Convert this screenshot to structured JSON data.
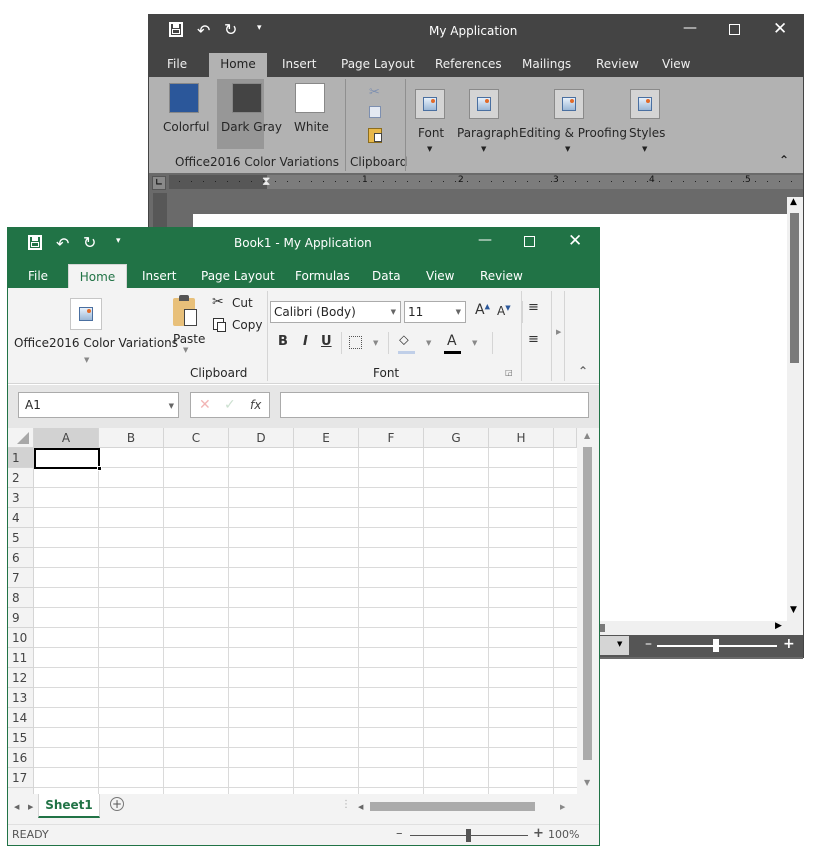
{
  "word_window": {
    "title": "My Application",
    "qat": [
      "save-icon",
      "undo-icon",
      "redo-icon",
      "customize-icon"
    ],
    "tabs": [
      {
        "label": "File",
        "active": false
      },
      {
        "label": "Home",
        "active": true
      },
      {
        "label": "Insert",
        "active": false
      },
      {
        "label": "Page Layout",
        "active": false
      },
      {
        "label": "References",
        "active": false
      },
      {
        "label": "Mailings",
        "active": false
      },
      {
        "label": "Review",
        "active": false
      },
      {
        "label": "View",
        "active": false
      }
    ],
    "ribbon": {
      "color_variations": {
        "group_label": "Office2016 Color Variations",
        "items": [
          {
            "label": "Colorful",
            "color": "#2b579a",
            "selected": false
          },
          {
            "label": "Dark Gray",
            "color": "#444444",
            "selected": true
          },
          {
            "label": "White",
            "color": "#ffffff",
            "selected": false
          }
        ]
      },
      "clipboard": {
        "group_label": "Clipboard",
        "icons": [
          "cut-icon",
          "copy-icon",
          "paste-icon"
        ]
      },
      "collapsed_groups": [
        {
          "label": "Font"
        },
        {
          "label": "Paragraph"
        },
        {
          "label": "Editing & Proofing"
        },
        {
          "label": "Styles"
        }
      ]
    },
    "ruler": {
      "numbers": [
        "1",
        "2",
        "3",
        "4",
        "5"
      ]
    },
    "zoom_slider": {
      "value_fraction": 0.5
    }
  },
  "excel_window": {
    "title": "Book1 - My Application",
    "tabs": [
      {
        "label": "File",
        "active": false
      },
      {
        "label": "Home",
        "active": true
      },
      {
        "label": "Insert",
        "active": false
      },
      {
        "label": "Page Layout",
        "active": false
      },
      {
        "label": "Formulas",
        "active": false
      },
      {
        "label": "Data",
        "active": false
      },
      {
        "label": "View",
        "active": false
      },
      {
        "label": "Review",
        "active": false
      }
    ],
    "ribbon": {
      "color_variations": {
        "label": "Office2016 Color Variations"
      },
      "clipboard": {
        "group_label": "Clipboard",
        "paste_label": "Paste",
        "cut_label": "Cut",
        "copy_label": "Copy"
      },
      "font": {
        "group_label": "Font",
        "font_name": "Calibri (Body)",
        "font_size": "11",
        "bold": "B",
        "italic": "I",
        "underline": "U",
        "font_color": "A"
      }
    },
    "formula_bar": {
      "name_box": "A1",
      "cancel": "✕",
      "enter": "✓",
      "fx": "fx",
      "formula": ""
    },
    "columns": [
      "A",
      "B",
      "C",
      "D",
      "E",
      "F",
      "G",
      "H"
    ],
    "rows": [
      "1",
      "2",
      "3",
      "4",
      "5",
      "6",
      "7",
      "8",
      "9",
      "10",
      "11",
      "12",
      "13",
      "14",
      "15",
      "16",
      "17"
    ],
    "selected_cell": "A1",
    "sheets": [
      {
        "label": "Sheet1",
        "active": true
      }
    ],
    "status": {
      "ready": "READY",
      "zoom": "100%",
      "zoom_fraction": 0.5,
      "minus": "–",
      "plus": "+"
    }
  }
}
